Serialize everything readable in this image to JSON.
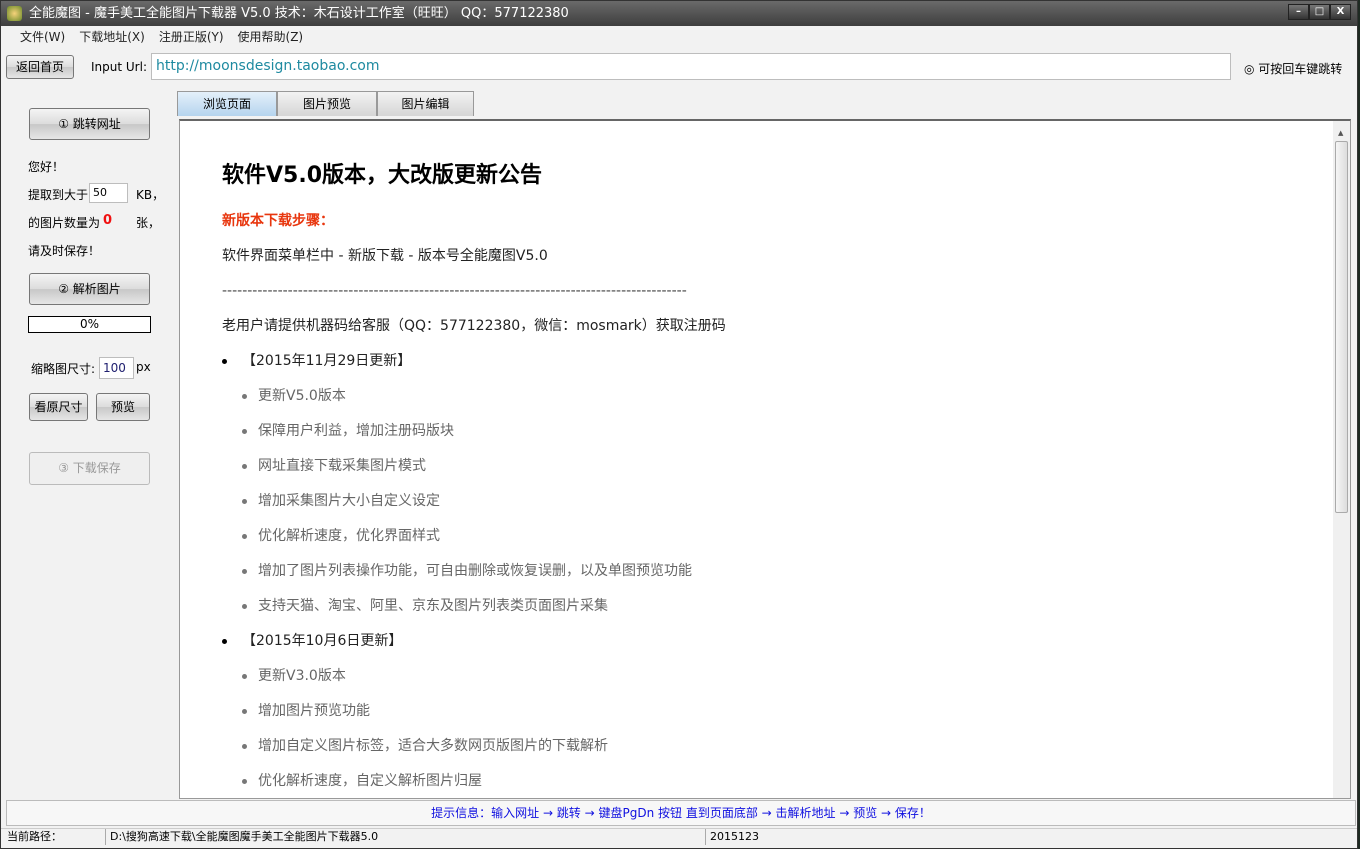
{
  "window": {
    "title": "全能魔图 - 魔手美工全能图片下载器 V5.0  技术：木石设计工作室（旺旺） QQ：577122380",
    "controls": [
      "minimize",
      "maximize",
      "close"
    ]
  },
  "menu": [
    "文件(W)",
    "下载地址(X)",
    "注册正版(Y)",
    "使用帮助(Z)"
  ],
  "toolbar": {
    "home_label": "返回首页",
    "url_label": "Input Url:",
    "url_value": "http://moonsdesign.taobao.com",
    "enter_hint": "◎ 可按回车键跳转"
  },
  "left": {
    "jump_label": "① 跳转网址",
    "greeting": "您好！",
    "size_prefix": "提取到大于",
    "size_value": "50",
    "size_unit": "KB，",
    "count_prefix": "的图片数量为",
    "count_value": "0",
    "count_unit": "张，",
    "save_reminder": "请及时保存！",
    "parse_label": "② 解析图片",
    "progress_text": "0%",
    "progress_value": 0,
    "thumb_label": "缩略图尺寸:",
    "thumb_value": "100",
    "thumb_unit": "px",
    "original_label": "看原尺寸",
    "preview_label": "预览",
    "download_label": "③ 下载保存"
  },
  "tabs": [
    {
      "label": "浏览页面",
      "active": true
    },
    {
      "label": "图片预览"
    },
    {
      "label": "图片编辑"
    }
  ],
  "doc": {
    "title": "软件V5.0版本，大改版更新公告",
    "steps_heading": "新版本下载步骤：",
    "steps_text": "软件界面菜单栏中 - 新版下载 - 版本号全能魔图V5.0",
    "divider": "--------------------------------------------------------------------------------------------",
    "contact": "老用户请提供机器码给客服（QQ：577122380，微信：mosmark）获取注册码",
    "updates": [
      {
        "heading": "【2015年11月29日更新】",
        "items": [
          "更新V5.0版本",
          "保障用户利益，增加注册码版块",
          "网址直接下载采集图片模式",
          "增加采集图片大小自定义设定",
          "优化解析速度，优化界面样式",
          "增加了图片列表操作功能，可自由删除或恢复误删，以及单图预览功能",
          "支持天猫、淘宝、阿里、京东及图片列表类页面图片采集"
        ]
      },
      {
        "heading": "【2015年10月6日更新】",
        "items": [
          "更新V3.0版本",
          "增加图片预览功能",
          "增加自定义图片标签，适合大多数网页版图片的下载解析",
          "优化解析速度，自定义解析图片归屋"
        ]
      }
    ]
  },
  "hint": "提示信息：输入网址 → 跳转 → 键盘PgDn 按钮 直到页面底部 → 击解析地址 → 预览 → 保存！",
  "status": {
    "path_label": "当前路径：",
    "path": "D:\\搜狗高速下载\\全能魔图魔手美工全能图片下载器5.0",
    "version": "2015123"
  },
  "colors": {
    "accent_red": "#e8360e",
    "hint_blue": "#1010e0",
    "url_teal": "#1e8aa0"
  }
}
